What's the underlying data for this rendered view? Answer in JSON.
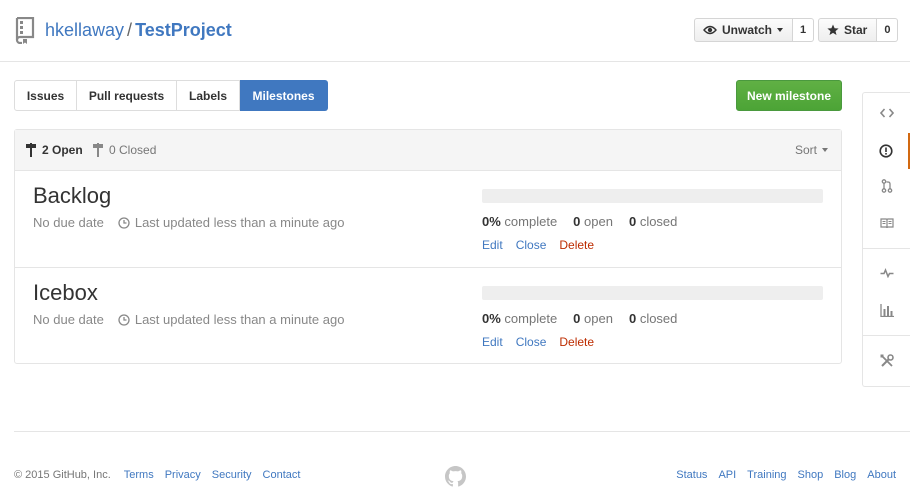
{
  "repo": {
    "owner": "hkellaway",
    "separator": "/",
    "name": "TestProject"
  },
  "header_actions": {
    "watch": {
      "label": "Unwatch",
      "count": "1"
    },
    "star": {
      "label": "Star",
      "count": "0"
    }
  },
  "subnav": {
    "items": [
      {
        "label": "Issues"
      },
      {
        "label": "Pull requests"
      },
      {
        "label": "Labels"
      },
      {
        "label": "Milestones"
      }
    ],
    "selected": "Milestones"
  },
  "new_milestone_label": "New milestone",
  "states": {
    "open": "2 Open",
    "closed": "0 Closed"
  },
  "sort_label": "Sort",
  "milestones": [
    {
      "title": "Backlog",
      "due": "No due date",
      "updated": "Last updated less than a minute ago",
      "progress_percent": 0,
      "complete_pct": "0%",
      "complete_word": "complete",
      "open_count": "0",
      "open_word": "open",
      "closed_count": "0",
      "closed_word": "closed",
      "actions": {
        "edit": "Edit",
        "close": "Close",
        "delete": "Delete"
      }
    },
    {
      "title": "Icebox",
      "due": "No due date",
      "updated": "Last updated less than a minute ago",
      "progress_percent": 0,
      "complete_pct": "0%",
      "complete_word": "complete",
      "open_count": "0",
      "open_word": "open",
      "closed_count": "0",
      "closed_word": "closed",
      "actions": {
        "edit": "Edit",
        "close": "Close",
        "delete": "Delete"
      }
    }
  ],
  "sidebar": {
    "items": [
      {
        "icon": "code-icon"
      },
      {
        "icon": "issue-opened-icon",
        "selected": true
      },
      {
        "icon": "git-pull-request-icon"
      },
      {
        "icon": "book-icon"
      },
      {
        "icon": "pulse-icon"
      },
      {
        "icon": "graph-icon"
      },
      {
        "icon": "tools-icon"
      }
    ]
  },
  "footer": {
    "copyright": "© 2015 GitHub, Inc.",
    "left_links": [
      "Terms",
      "Privacy",
      "Security",
      "Contact"
    ],
    "right_links": [
      "Status",
      "API",
      "Training",
      "Shop",
      "Blog",
      "About"
    ]
  },
  "colors": {
    "link": "#4078c0",
    "accent_green": "#55a532",
    "danger": "#bd2c00",
    "selected_tab": "#4078c0",
    "sidebar_selected": "#d26911"
  }
}
